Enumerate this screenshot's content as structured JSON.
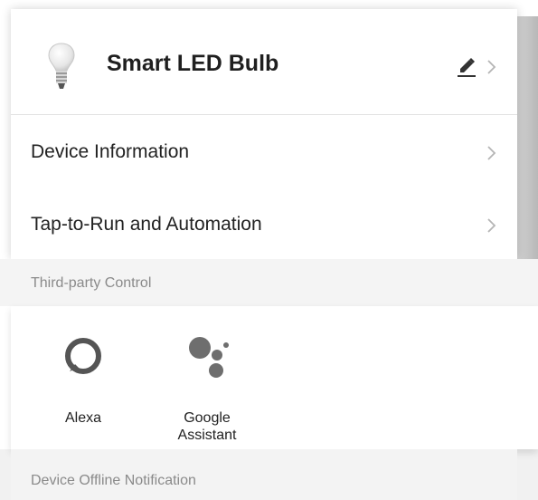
{
  "device": {
    "name": "Smart LED Bulb",
    "icon": "light-bulb-icon"
  },
  "menu": [
    {
      "label": "Device Information"
    },
    {
      "label": "Tap-to-Run and Automation"
    }
  ],
  "third_party": {
    "section_title": "Third-party Control",
    "services": [
      {
        "name": "Alexa",
        "icon": "alexa-icon"
      },
      {
        "name": "Google Assistant",
        "icon": "google-assistant-icon"
      }
    ]
  },
  "offline": {
    "section_title": "Device Offline Notification"
  }
}
